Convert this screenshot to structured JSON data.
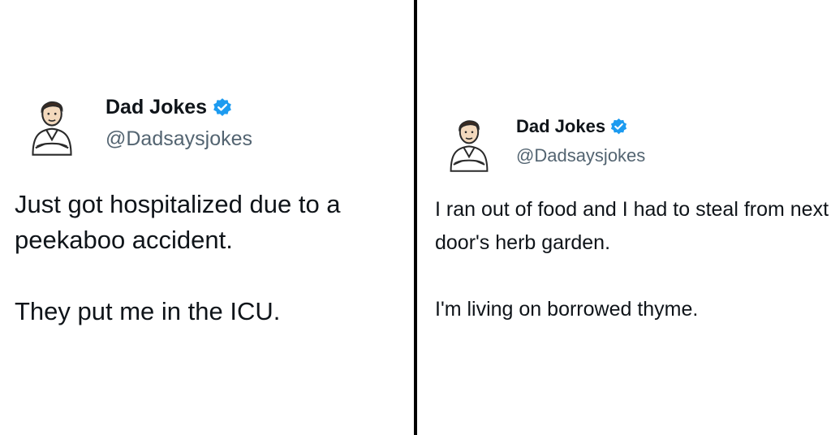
{
  "tweets": [
    {
      "display_name": "Dad Jokes",
      "handle": "@Dadsaysjokes",
      "avatar_icon": "cartoon-man-avatar-icon",
      "verified_icon": "verified-badge-icon",
      "paragraphs": [
        "Just got hospitalized due to a peekaboo accident.",
        "They put me in the ICU."
      ]
    },
    {
      "display_name": "Dad Jokes",
      "handle": "@Dadsaysjokes",
      "avatar_icon": "cartoon-man-avatar-icon",
      "verified_icon": "verified-badge-icon",
      "paragraphs": [
        "I ran out of food and I had to steal from next door's herb garden.",
        "I'm living on borrowed thyme."
      ]
    }
  ],
  "colors": {
    "verified": "#1d9bf0",
    "handle": "#536471",
    "text": "#0f1419",
    "divider": "#000000"
  }
}
